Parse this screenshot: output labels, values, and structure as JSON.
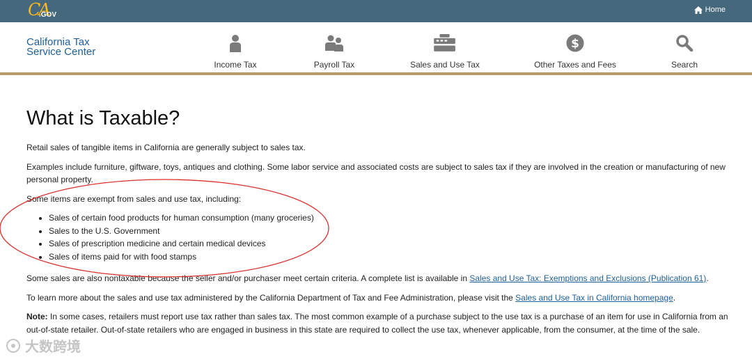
{
  "topbar": {
    "logo_ca": "CA",
    "logo_gov": ".GOV",
    "home_label": "Home"
  },
  "header": {
    "brand_line1": "California Tax",
    "brand_line2": "Service Center",
    "nav": [
      {
        "label": "Income Tax",
        "icon": "person-icon"
      },
      {
        "label": "Payroll Tax",
        "icon": "people-icon"
      },
      {
        "label": "Sales and Use Tax",
        "icon": "cash-register-icon"
      },
      {
        "label": "Other Taxes and Fees",
        "icon": "dollar-circle-icon"
      },
      {
        "label": "Search",
        "icon": "search-icon"
      }
    ]
  },
  "main": {
    "title": "What is Taxable?",
    "p1": "Retail sales of tangible items in California are generally subject to sales tax.",
    "p2": "Examples include furniture, giftware, toys, antiques and clothing. Some labor service and associated costs are subject to sales tax if they are involved in the creation or manufacturing of new personal property.",
    "p3": "Some items are exempt from sales and use tax, including:",
    "exempt_items": [
      "Sales of certain food products for human consumption (many groceries)",
      "Sales to the U.S. Government",
      "Sales of prescription medicine and certain medical devices",
      "Sales of items paid for with food stamps"
    ],
    "p4_text": "Some sales are also nontaxable because the seller and/or purchaser meet certain criteria. A complete list is available in ",
    "p4_link": "Sales and Use Tax: Exemptions and Exclusions (Publication 61)",
    "p4_end": ".",
    "p5_text": "To learn more about the sales and use tax administered by the California Department of Tax and Fee Administration, please visit the ",
    "p5_link": "Sales and Use Tax in California homepage",
    "p5_end": ".",
    "note_label": "Note:",
    "note_text": " In some cases, retailers must report use tax rather than sales tax. The most common example of a purchase subject to the use tax is a purchase of an item for use in California from an out-of-state retailer. Out-of-state retailers who are engaged in business in this state are required to collect the use tax, whenever applicable, from the consumer, at the time of the sale."
  },
  "annotation_color": "#d9302c",
  "watermark": "大数跨境"
}
